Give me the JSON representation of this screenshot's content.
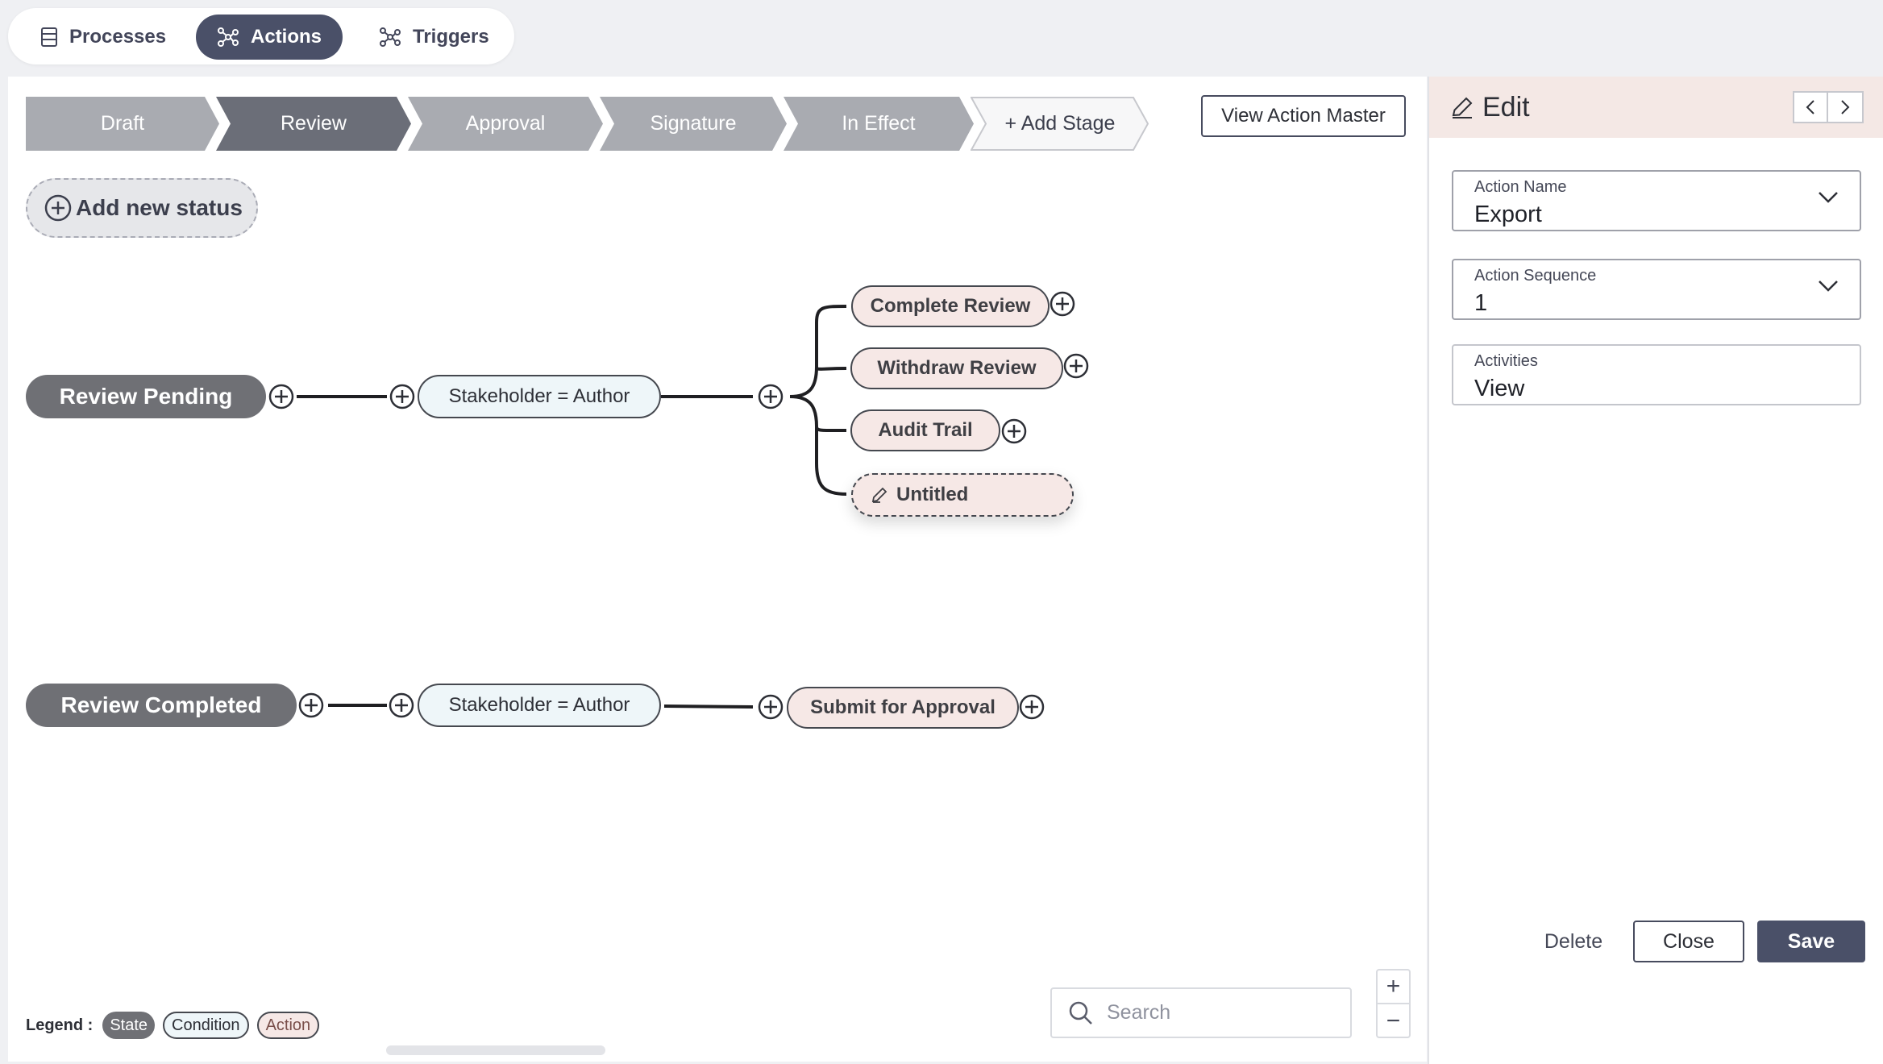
{
  "tabs": [
    {
      "label": "Processes",
      "icon": "list-icon",
      "active": false
    },
    {
      "label": "Actions",
      "icon": "network-icon",
      "active": true
    },
    {
      "label": "Triggers",
      "icon": "network-icon",
      "active": false
    }
  ],
  "stages": [
    "Draft",
    "Review",
    "Approval",
    "Signature",
    "In Effect"
  ],
  "active_stage": "Review",
  "add_stage_label": "+ Add Stage",
  "view_action_master_label": "View Action Master",
  "add_status_label": "Add new status",
  "flows": [
    {
      "state": "Review Pending",
      "condition": "Stakeholder = Author",
      "actions": [
        "Complete Review",
        "Withdraw Review",
        "Audit Trail",
        "Untitled"
      ]
    },
    {
      "state": "Review Completed",
      "condition": "Stakeholder = Author",
      "actions": [
        "Submit for Approval"
      ]
    }
  ],
  "legend": {
    "label": "Legend :",
    "state": "State",
    "condition": "Condition",
    "action": "Action"
  },
  "search": {
    "placeholder": "Search",
    "value": ""
  },
  "zoom": {
    "in": "+",
    "out": "−"
  },
  "panel": {
    "title": "Edit",
    "fields": [
      {
        "label": "Action Name",
        "value": "Export",
        "type": "dropdown"
      },
      {
        "label": "Action Sequence",
        "value": "1",
        "type": "dropdown"
      },
      {
        "label": "Activities",
        "value": "View",
        "type": "text"
      }
    ],
    "buttons": {
      "delete": "Delete",
      "close": "Close",
      "save": "Save"
    }
  },
  "colors": {
    "accent": "#4a5068",
    "stage": "#a9abb1",
    "stage_active": "#6b6e78",
    "state": "#6f7075",
    "condition_bg": "#eef6f9",
    "action_bg": "#f6e8e6",
    "panel_header": "#f4e8e5"
  }
}
